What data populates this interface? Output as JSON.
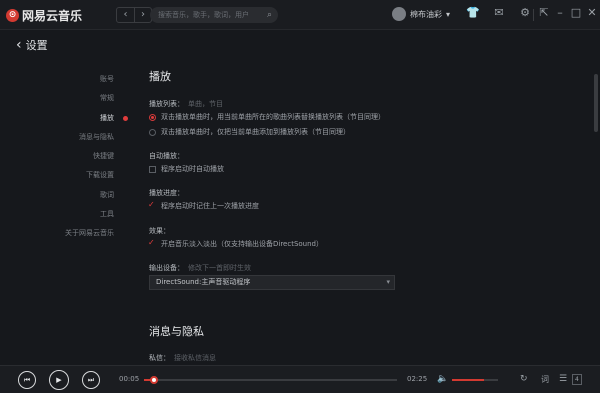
{
  "app": {
    "logo_text": "网易云音乐",
    "logo_glyph": "⊙"
  },
  "titlebar": {
    "back_glyph": "‹",
    "forward_glyph": "›",
    "search_placeholder": "搜索音乐，歌手，歌词，用户",
    "search_icon": "⌕",
    "username": "棉布油彩",
    "user_caret": "▾",
    "icons": {
      "skin": "👕",
      "mail": "✉",
      "settings": "⚙"
    },
    "window": {
      "mini": "⇱",
      "minimize": "–",
      "maximize": "□",
      "close": "✕"
    }
  },
  "header": {
    "back_glyph": "‹",
    "title": "设置"
  },
  "nav": [
    {
      "label": "账号",
      "active": false
    },
    {
      "label": "常规",
      "active": false
    },
    {
      "label": "播放",
      "active": true
    },
    {
      "label": "消息与隐私",
      "active": false
    },
    {
      "label": "快捷键",
      "active": false
    },
    {
      "label": "下载设置",
      "active": false
    },
    {
      "label": "歌词",
      "active": false
    },
    {
      "label": "工具",
      "active": false
    },
    {
      "label": "关于网易云音乐",
      "active": false
    }
  ],
  "play_section": {
    "title": "播放",
    "list_label": "播放列表：",
    "list_sub": "单曲，节目",
    "list_opt1": "双击播放单曲时，用当前单曲所在的歌曲列表替换播放列表（节目同理）",
    "list_opt2": "双击播放单曲时，仅把当前单曲添加到播放列表（节目同理）",
    "auto_label": "自动播放：",
    "auto_opt": "程序启动时自动播放",
    "progress_label": "播放进度：",
    "progress_opt": "程序启动时记住上一次播放进度",
    "effect_label": "效果：",
    "effect_opt": "开启音乐淡入淡出（仅支持输出设备DirectSound）",
    "output_label": "输出设备：",
    "output_sub": "修改下一首即时生效",
    "output_value": "DirectSound:主声音驱动程序",
    "output_caret": "▾"
  },
  "privacy_section": {
    "title": "消息与隐私",
    "msg_label": "私信：",
    "msg_sub": "接收私信消息"
  },
  "player": {
    "prev": "⏮",
    "play": "▶",
    "next": "⏭",
    "current_time": "00:05",
    "total_time": "02:25",
    "progress_fraction": 0.04,
    "volume_fraction": 0.7,
    "volume_icon": "🔈",
    "mode_icon": "↻",
    "lyric_icon": "词",
    "playlist_icon": "☰",
    "playlist_count": "4",
    "accent": "#d33a31"
  }
}
